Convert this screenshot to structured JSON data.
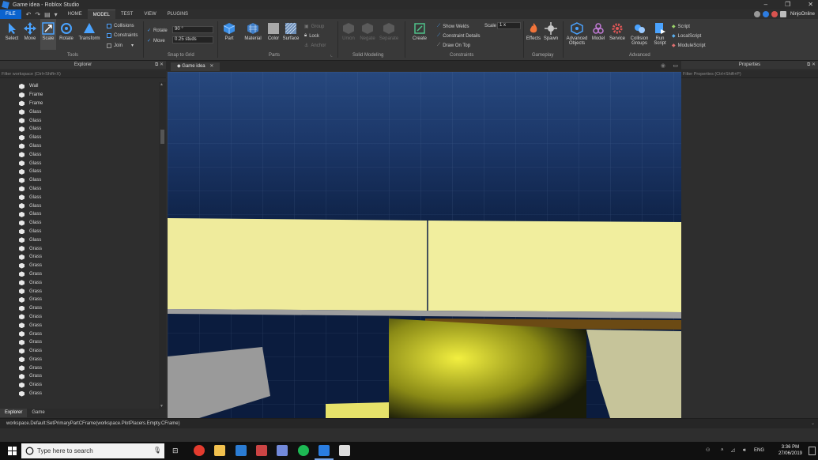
{
  "window": {
    "title": "Game idea - Roblox Studio",
    "controls": [
      "–",
      "❐",
      "✕"
    ]
  },
  "menu": {
    "file": "FILE",
    "tabs": [
      "HOME",
      "MODEL",
      "TEST",
      "VIEW",
      "PLUGINS"
    ],
    "active_tab": "MODEL",
    "username": "NinjoOnline"
  },
  "ribbon": {
    "tools": {
      "select": "Select",
      "move": "Move",
      "scale": "Scale",
      "rotate": "Rotate",
      "transform": "Transform",
      "label": "Tools"
    },
    "toggles": {
      "collisions": "Collisions",
      "constraints": "Constraints",
      "join": "Join"
    },
    "snap": {
      "rotate_label": "Rotate",
      "rotate_value": "90 °",
      "move_label": "Move",
      "move_value": "0.25 studs",
      "label": "Snap to Grid"
    },
    "parts": {
      "part": "Part",
      "material": "Material",
      "color": "Color",
      "surface": "Surface",
      "group": "Group",
      "lock": "Lock",
      "anchor": "Anchor",
      "label": "Parts"
    },
    "solid": {
      "union": "Union",
      "negate": "Negate",
      "separate": "Separate",
      "label": "Solid Modeling"
    },
    "constraints": {
      "create": "Create",
      "show_welds": "Show Welds",
      "constraint_details": "Constraint Details",
      "draw_on_top": "Draw On Top",
      "scale_label": "Scale",
      "scale_value": "1 x",
      "label": "Constraints"
    },
    "gameplay": {
      "effects": "Effects",
      "spawn": "Spawn",
      "label": "Gameplay"
    },
    "advanced": {
      "advanced_objects": "Advanced Objects",
      "model": "Model",
      "service": "Service",
      "collision_groups": "Collision Groups",
      "run_script": "Run Script",
      "script": "Script",
      "local_script": "LocalScript",
      "module_script": "ModuleScript",
      "label": "Advanced"
    }
  },
  "explorer": {
    "title": "Explorer",
    "filter_placeholder": "Filter workspace (Ctrl+Shift+X)",
    "items": [
      "Wall",
      "Frame",
      "Frame",
      "Glass",
      "Glass",
      "Glass",
      "Glass",
      "Glass",
      "Glass",
      "Glass",
      "Glass",
      "Glass",
      "Glass",
      "Glass",
      "Glass",
      "Glass",
      "Glass",
      "Glass",
      "Glass",
      "Grass",
      "Grass",
      "Grass",
      "Grass",
      "Grass",
      "Grass",
      "Grass",
      "Grass",
      "Grass",
      "Grass",
      "Grass",
      "Grass",
      "Grass",
      "Grass",
      "Grass",
      "Grass",
      "Grass",
      "Grass"
    ],
    "bottom_tabs": [
      "Explorer",
      "Game"
    ]
  },
  "document": {
    "tab": "Game idea"
  },
  "properties": {
    "title": "Properties",
    "filter_placeholder": "Filter Properties (Ctrl+Shift+P)"
  },
  "command_bar": {
    "text": "workspace.Default:SetPrimaryPartCFrame(workspace.PlotPlacers.Empty.CFrame)"
  },
  "taskbar": {
    "search_placeholder": "Type here to search",
    "lang": "ENG",
    "time": "3:36 PM",
    "date": "27/06/2019"
  }
}
